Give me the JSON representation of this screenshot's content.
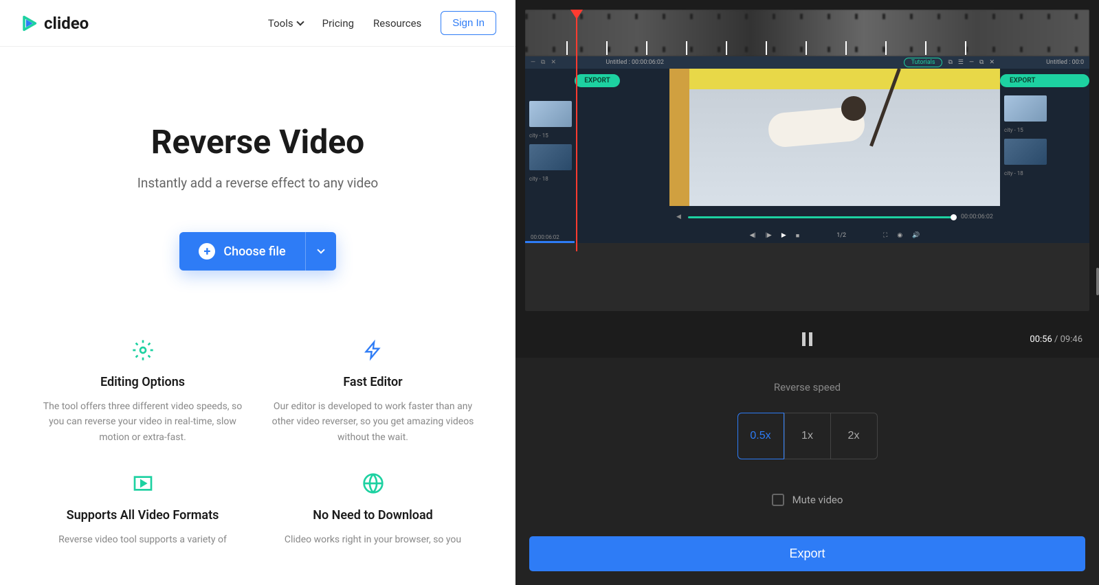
{
  "header": {
    "logo_text": "clideo",
    "nav": {
      "tools": "Tools",
      "pricing": "Pricing",
      "resources": "Resources",
      "signin": "Sign In"
    }
  },
  "hero": {
    "title": "Reverse Video",
    "subtitle": "Instantly add a reverse effect to any video",
    "choose_file": "Choose file"
  },
  "features": [
    {
      "title": "Editing Options",
      "desc": "The tool offers three different video speeds, so you can reverse your video in real-time, slow motion or extra-fast."
    },
    {
      "title": "Fast Editor",
      "desc": "Our editor is developed to work faster than any other video reverser, so you get amazing videos without the wait."
    },
    {
      "title": "Supports All Video Formats",
      "desc": "Reverse video tool supports a variety of"
    },
    {
      "title": "No Need to Download",
      "desc": "Clideo works right in your browser, so you"
    }
  ],
  "editor": {
    "window_title_left": "Untitled : 00:00:06:02",
    "window_title_right": "Untitled : 00:0",
    "tutorials": "Tutorials",
    "export_badge": "EXPORT",
    "thumb1": "city - 15",
    "thumb2": "city - 18",
    "timecode_left": "00:00:06:02",
    "timecode_right": "00:00:06:02",
    "page": "1/2",
    "time_current": "00:56",
    "time_total": "09:46"
  },
  "settings": {
    "speed_label": "Reverse speed",
    "speeds": [
      "0.5x",
      "1x",
      "2x"
    ],
    "mute_label": "Mute video",
    "export": "Export"
  }
}
